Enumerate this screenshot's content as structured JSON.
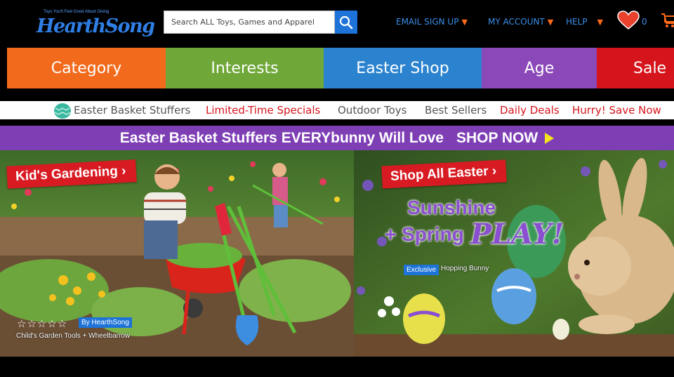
{
  "header": {
    "logo_tagline": "Toys You'll Feel Good About Giving",
    "logo_text": "HearthSong",
    "search_placeholder": "Search ALL Toys, Games and Apparel",
    "email_signup": "EMAIL SIGN UP",
    "my_account": "MY ACCOUNT",
    "help": "HELP",
    "wishlist_count": "0"
  },
  "main_nav": [
    {
      "label": "Category",
      "color": "#f26a1b"
    },
    {
      "label": "Interests",
      "color": "#6fa838"
    },
    {
      "label": "Easter Shop",
      "color": "#2b83cf"
    },
    {
      "label": "Age",
      "color": "#8a48b8"
    },
    {
      "label": "Sale",
      "color": "#d6141b"
    }
  ],
  "sub_nav": [
    {
      "label": "Easter Basket Stuffers",
      "color": "#555555"
    },
    {
      "label": "Limited-Time Specials",
      "color": "#d6141b"
    },
    {
      "label": "Outdoor Toys",
      "color": "#555555"
    },
    {
      "label": "Best Sellers",
      "color": "#555555"
    },
    {
      "label": "Daily Deals",
      "color": "#d6141b"
    },
    {
      "label": "Hurry! Save Now",
      "color": "#d6141b"
    }
  ],
  "promo": {
    "text": "Easter Basket Stuffers EVERYbunny Will Love",
    "cta": "SHOP NOW"
  },
  "hero_left": {
    "ribbon": "Kid's Gardening ›",
    "rating_stars": "☆☆☆☆☆",
    "badge": "By HearthSong",
    "caption": "Child's Garden Tools + Wheelbarrow"
  },
  "hero_right": {
    "ribbon": "Shop All Easter ›",
    "headline_1": "Sunshine",
    "headline_2": "+ Spring",
    "headline_3": "PLAY!",
    "badge": "Exclusive",
    "caption": "Hopping Bunny"
  }
}
